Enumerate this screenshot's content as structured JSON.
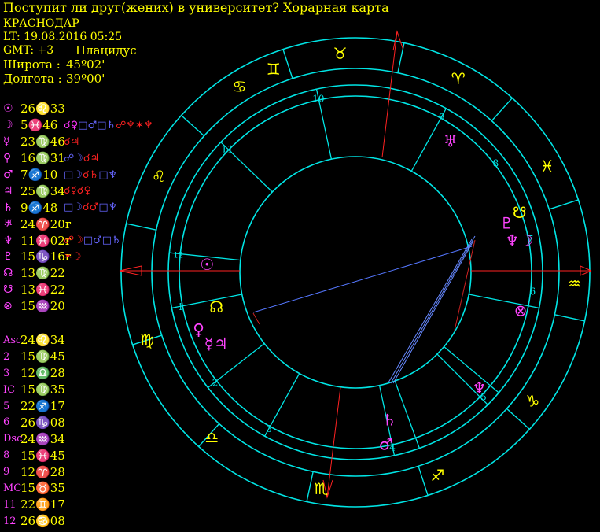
{
  "header": {
    "title": "Поступит ли друг(жених) в университет? Хорарная карта",
    "city": "КРАСНОДАР",
    "lt": "LT: 19.08.2016  05:25",
    "gmt": "GMT: +3",
    "system": "Плацидус",
    "lat_label": "Широта :",
    "lat_value": "45º02'",
    "lon_label": "Долгота :",
    "lon_value": "39º00'"
  },
  "planets": [
    {
      "glyph": "☉",
      "pos": "26♌33",
      "aspects": []
    },
    {
      "glyph": "☽",
      "pos": " 5♓46",
      "aspects": [
        {
          "t": "☌♀",
          "c": "#ff33ff"
        },
        {
          "t": "□♂",
          "c": "#6666ff"
        },
        {
          "t": "□♄",
          "c": "#6666ff"
        },
        {
          "t": "☍♆",
          "c": "#ff2222"
        },
        {
          "t": "✶♆",
          "c": "#ff2222"
        }
      ]
    },
    {
      "glyph": "☿",
      "pos": "23♍46",
      "aspects": [
        {
          "t": "☌♃",
          "c": "#ff2222"
        }
      ]
    },
    {
      "glyph": "♀",
      "pos": "16♍31",
      "aspects": [
        {
          "t": "☍☽",
          "c": "#6666ff"
        },
        {
          "t": "☌♃",
          "c": "#ff2222"
        }
      ]
    },
    {
      "glyph": "♂",
      "pos": " 7♐10",
      "aspects": [
        {
          "t": "□☽",
          "c": "#6666ff"
        },
        {
          "t": "☌♄",
          "c": "#ff2222"
        },
        {
          "t": "□♆",
          "c": "#6666ff"
        }
      ]
    },
    {
      "glyph": "♃",
      "pos": "25♍34",
      "aspects": [
        {
          "t": "☌☿",
          "c": "#ff2222"
        },
        {
          "t": "☌♀",
          "c": "#ff2222"
        }
      ]
    },
    {
      "glyph": "♄",
      "pos": " 9♐48",
      "aspects": [
        {
          "t": "□☽",
          "c": "#6666ff"
        },
        {
          "t": "☌♂",
          "c": "#ff2222"
        },
        {
          "t": "□♆",
          "c": "#6666ff"
        }
      ]
    },
    {
      "glyph": "♅",
      "pos": "24♈20r",
      "aspects": []
    },
    {
      "glyph": "♆",
      "pos": "11♓02r",
      "aspects": [
        {
          "t": "☍☽",
          "c": "#ff2222"
        },
        {
          "t": "□♂",
          "c": "#6666ff"
        },
        {
          "t": "□♄",
          "c": "#6666ff"
        }
      ]
    },
    {
      "glyph": "♇",
      "pos": "15♑16r",
      "aspects": [
        {
          "t": "✶☽",
          "c": "#ff2222"
        }
      ]
    },
    {
      "glyph": "☊",
      "pos": "13♍22",
      "aspects": []
    },
    {
      "glyph": "☋",
      "pos": "13♓22",
      "aspects": []
    },
    {
      "glyph": "⊗",
      "pos": "15♒20",
      "aspects": []
    }
  ],
  "houses": [
    {
      "label": "Asc",
      "pos": "24♌34"
    },
    {
      "label": "2",
      "pos": "15♍45"
    },
    {
      "label": "3",
      "pos": "12♎28"
    },
    {
      "label": "IC",
      "pos": "15♍35"
    },
    {
      "label": "5",
      "pos": "22♐17"
    },
    {
      "label": "6",
      "pos": "26♑08"
    },
    {
      "label": "Dsc",
      "pos": "24♒34"
    },
    {
      "label": "8",
      "pos": "15♓45"
    },
    {
      "label": "9",
      "pos": "12♈28"
    },
    {
      "label": "MC",
      "pos": "15♉35"
    },
    {
      "label": "11",
      "pos": "22♊17"
    },
    {
      "label": "12",
      "pos": "26♋08"
    }
  ],
  "wheel": {
    "sign_glyphs": [
      {
        "g": "♉",
        "a": 94
      },
      {
        "g": "♈",
        "a": 62
      },
      {
        "g": "♓",
        "a": 29
      },
      {
        "g": "♒",
        "a": -3
      },
      {
        "g": "♑",
        "a": -36
      },
      {
        "g": "♐",
        "a": -68
      },
      {
        "g": "♏",
        "a": -99
      },
      {
        "g": "♎",
        "a": -131
      },
      {
        "g": "♍",
        "a": -162
      },
      {
        "g": "♌",
        "a": 154
      },
      {
        "g": "♋",
        "a": 122
      },
      {
        "g": "♊",
        "a": 112
      }
    ],
    "house_numbers": [
      {
        "n": "1",
        "a": 191
      },
      {
        "n": "2",
        "a": 218
      },
      {
        "n": "3",
        "a": 241
      },
      {
        "n": "4",
        "a": 282
      },
      {
        "n": "5",
        "a": 316
      },
      {
        "n": "6",
        "a": 354
      },
      {
        "n": "7",
        "a": 11
      },
      {
        "n": "8",
        "a": 38
      },
      {
        "n": "9",
        "a": 61
      },
      {
        "n": "10",
        "a": 102
      },
      {
        "n": "11",
        "a": 136
      },
      {
        "n": "12",
        "a": 174
      }
    ],
    "planet_glyphs": [
      {
        "g": "☉",
        "a": 177,
        "r": 0.57,
        "c": "#ff44ff"
      },
      {
        "g": "☊",
        "a": 194,
        "r": 0.55,
        "c": "#ffff00"
      },
      {
        "g": "♀",
        "a": 200,
        "r": 0.64,
        "c": "#ff44ff"
      },
      {
        "g": "☿♃",
        "a": 207,
        "r": 0.6,
        "c": "#ff44ff"
      },
      {
        "g": "♅",
        "a": 54,
        "r": 0.62,
        "c": "#ff44ff"
      },
      {
        "g": "♇",
        "a": 18,
        "r": 0.61,
        "c": "#ff44ff"
      },
      {
        "g": "☋",
        "a": 20,
        "r": 0.67,
        "c": "#ffff00"
      },
      {
        "g": "♆☽",
        "a": 11,
        "r": 0.64,
        "c": "#ff44ff"
      },
      {
        "g": "⊗",
        "a": -13,
        "r": 0.65,
        "c": "#ff44ff"
      },
      {
        "g": "♆",
        "a": -43,
        "r": 0.65,
        "c": "#ff44ff"
      },
      {
        "g": "♄",
        "a": -77,
        "r": 0.58,
        "c": "#ff44ff"
      },
      {
        "g": "♂",
        "a": -80,
        "r": 0.67,
        "c": "#ff44ff"
      }
    ]
  }
}
